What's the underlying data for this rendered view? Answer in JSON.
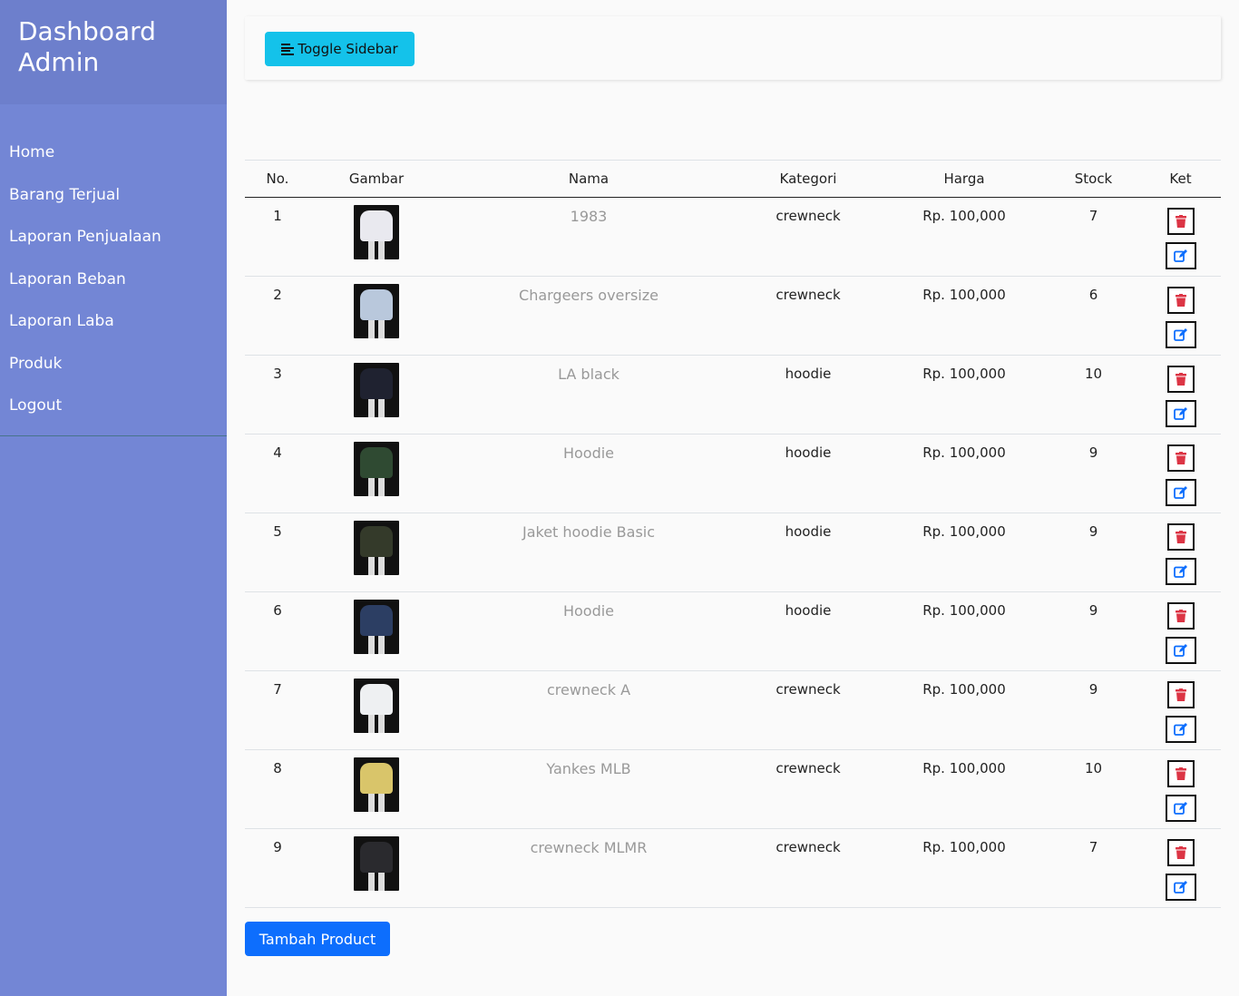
{
  "sidebar": {
    "title": "Dashboard Admin",
    "items": [
      {
        "label": "Home"
      },
      {
        "label": "Barang Terjual"
      },
      {
        "label": "Laporan Penjualaan"
      },
      {
        "label": "Laporan Beban"
      },
      {
        "label": "Laporan Laba"
      },
      {
        "label": "Produk"
      },
      {
        "label": "Logout"
      }
    ]
  },
  "topbar": {
    "toggle_label": "Toggle Sidebar",
    "toggle_icon": "align-left-icon"
  },
  "table": {
    "headers": [
      "No.",
      "Gambar",
      "Nama",
      "Kategori",
      "Harga",
      "Stock",
      "Ket"
    ],
    "rows": [
      {
        "no": "1",
        "nama": "1983",
        "kategori": "crewneck",
        "harga": "Rp. 100,000",
        "stock": "7",
        "color": "#e9e9ef"
      },
      {
        "no": "2",
        "nama": "Chargeers oversize",
        "kategori": "crewneck",
        "harga": "Rp. 100,000",
        "stock": "6",
        "color": "#b9c8dc"
      },
      {
        "no": "3",
        "nama": "LA black",
        "kategori": "hoodie",
        "harga": "Rp. 100,000",
        "stock": "10",
        "color": "#1f2230"
      },
      {
        "no": "4",
        "nama": "Hoodie",
        "kategori": "hoodie",
        "harga": "Rp. 100,000",
        "stock": "9",
        "color": "#2f4a32"
      },
      {
        "no": "5",
        "nama": "Jaket hoodie Basic",
        "kategori": "hoodie",
        "harga": "Rp. 100,000",
        "stock": "9",
        "color": "#343a2a"
      },
      {
        "no": "6",
        "nama": "Hoodie",
        "kategori": "hoodie",
        "harga": "Rp. 100,000",
        "stock": "9",
        "color": "#2c3e63"
      },
      {
        "no": "7",
        "nama": "crewneck A",
        "kategori": "crewneck",
        "harga": "Rp. 100,000",
        "stock": "9",
        "color": "#eef0f2"
      },
      {
        "no": "8",
        "nama": "Yankes MLB",
        "kategori": "crewneck",
        "harga": "Rp. 100,000",
        "stock": "10",
        "color": "#d9c56a"
      },
      {
        "no": "9",
        "nama": "crewneck MLMR",
        "kategori": "crewneck",
        "harga": "Rp. 100,000",
        "stock": "7",
        "color": "#2a2a2e"
      }
    ]
  },
  "add_button": {
    "label": "Tambah Product"
  },
  "icons": {
    "delete": "trash-icon",
    "edit": "edit-icon"
  },
  "colors": {
    "sidebar": "#7386d5",
    "toggle": "#14c2ea",
    "primary": "#0d6efd",
    "delete": "#dc3545",
    "edit": "#0d6efd"
  }
}
